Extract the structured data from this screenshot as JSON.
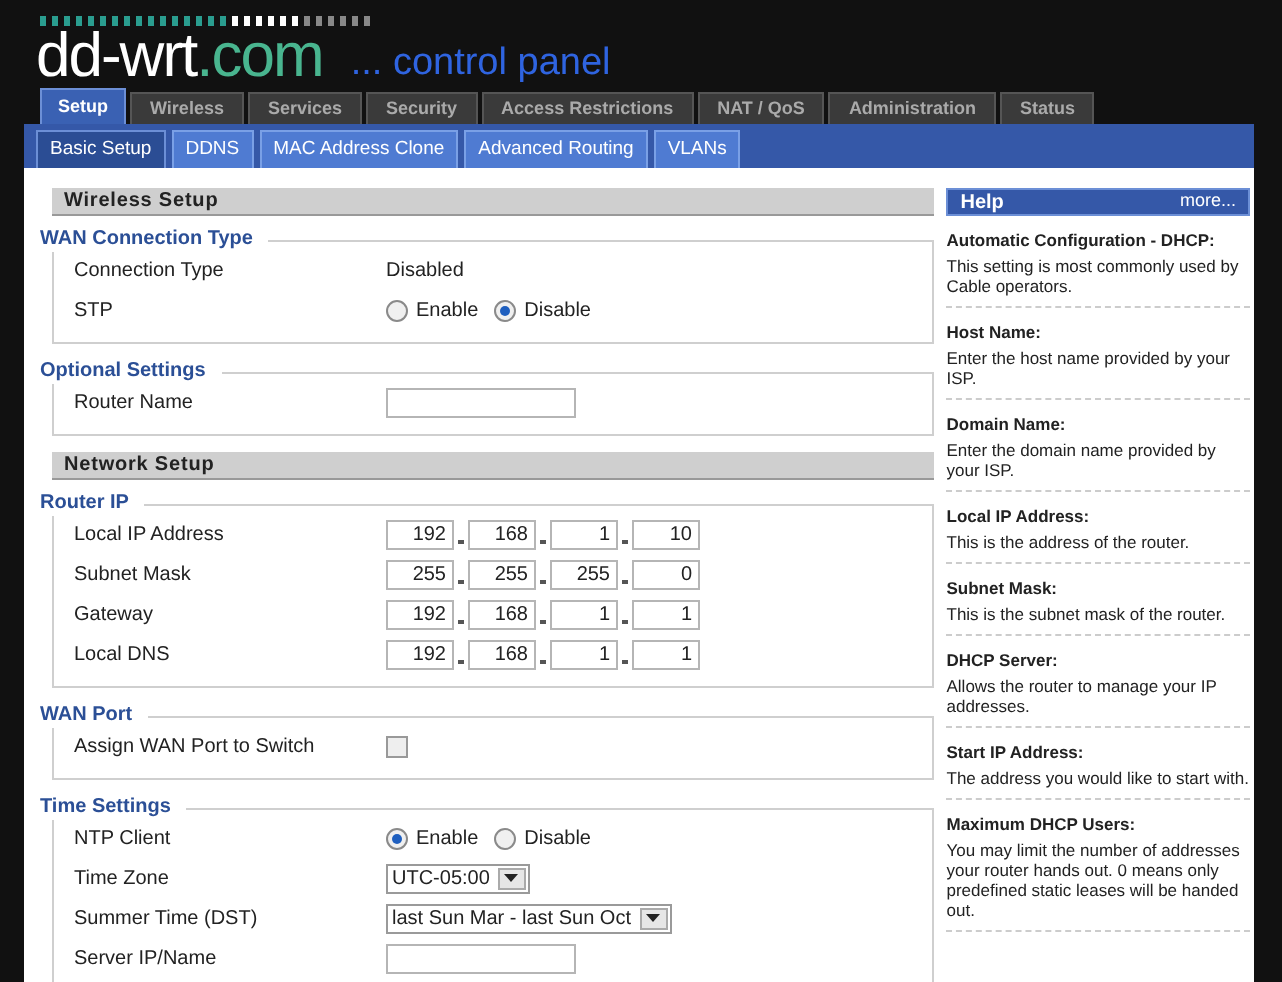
{
  "header": {
    "logo_main": "dd-wrt",
    "logo_domain": ".com",
    "subtitle": "... control panel"
  },
  "tabs": [
    {
      "label": "Setup",
      "selected": true
    },
    {
      "label": "Wireless",
      "selected": false
    },
    {
      "label": "Services",
      "selected": false
    },
    {
      "label": "Security",
      "selected": false
    },
    {
      "label": "Access Restrictions",
      "selected": false
    },
    {
      "label": "NAT / QoS",
      "selected": false
    },
    {
      "label": "Administration",
      "selected": false
    },
    {
      "label": "Status",
      "selected": false
    }
  ],
  "subtabs": [
    {
      "label": "Basic Setup",
      "selected": true
    },
    {
      "label": "DDNS",
      "selected": false
    },
    {
      "label": "MAC Address Clone",
      "selected": false
    },
    {
      "label": "Advanced Routing",
      "selected": false
    },
    {
      "label": "VLANs",
      "selected": false
    }
  ],
  "sections": [
    {
      "kind": "header",
      "title": "Wireless Setup"
    },
    {
      "kind": "group",
      "title": "WAN Connection Type",
      "rows": [
        {
          "kind": "text",
          "label": "Connection Type",
          "value": "Disabled"
        },
        {
          "kind": "radio",
          "label": "STP",
          "options": [
            {
              "label": "Enable",
              "selected": false
            },
            {
              "label": "Disable",
              "selected": true
            }
          ]
        }
      ]
    },
    {
      "kind": "group",
      "title": "Optional Settings",
      "rows": [
        {
          "kind": "field",
          "label": "Router Name"
        }
      ]
    },
    {
      "kind": "header",
      "title": "Network Setup"
    },
    {
      "kind": "group",
      "title": "Router IP",
      "rows": [
        {
          "kind": "ip",
          "label": "Local IP Address",
          "octets": [
            "192",
            "168",
            "1",
            "10"
          ]
        },
        {
          "kind": "ip",
          "label": "Subnet Mask",
          "octets": [
            "255",
            "255",
            "255",
            "0"
          ]
        },
        {
          "kind": "ip",
          "label": "Gateway",
          "octets": [
            "192",
            "168",
            "1",
            "1"
          ]
        },
        {
          "kind": "ip",
          "label": "Local DNS",
          "octets": [
            "192",
            "168",
            "1",
            "1"
          ]
        }
      ]
    },
    {
      "kind": "group",
      "title": "WAN Port",
      "rows": [
        {
          "kind": "checkbox",
          "label": "Assign WAN Port to Switch",
          "checked": false
        }
      ]
    },
    {
      "kind": "group",
      "title": "Time Settings",
      "rows": [
        {
          "kind": "radio",
          "label": "NTP Client",
          "options": [
            {
              "label": "Enable",
              "selected": true
            },
            {
              "label": "Disable",
              "selected": false
            }
          ]
        },
        {
          "kind": "select",
          "label": "Time Zone",
          "value": "UTC-05:00"
        },
        {
          "kind": "select",
          "label": "Summer Time (DST)",
          "value": "last Sun Mar - last Sun Oct"
        },
        {
          "kind": "field",
          "label": "Server IP/Name"
        }
      ]
    }
  ],
  "help": {
    "title": "Help",
    "more": "more...",
    "items": [
      {
        "title": "Automatic Configuration - DHCP:",
        "text": "This setting is most commonly used by Cable operators."
      },
      {
        "title": "Host Name:",
        "text": "Enter the host name provided by your ISP."
      },
      {
        "title": "Domain Name:",
        "text": "Enter the domain name provided by your ISP."
      },
      {
        "title": "Local IP Address:",
        "text": "This is the address of the router."
      },
      {
        "title": "Subnet Mask:",
        "text": "This is the subnet mask of the router."
      },
      {
        "title": "DHCP Server:",
        "text": "Allows the router to manage your IP addresses."
      },
      {
        "title": "Start IP Address:",
        "text": "The address you would like to start with."
      },
      {
        "title": "Maximum DHCP Users:",
        "text": "You may limit the number of addresses your router hands out. 0 means only predefined static leases will be handed out."
      }
    ]
  }
}
